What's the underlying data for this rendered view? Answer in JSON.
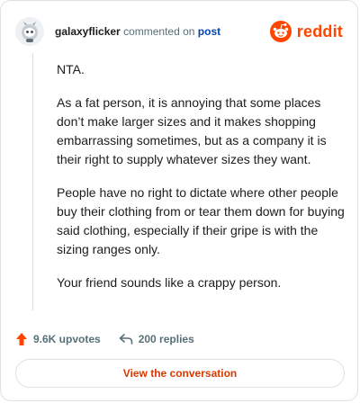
{
  "header": {
    "username": "galaxyflicker",
    "action": "commented on",
    "post_link": "post",
    "logo_text": "reddit",
    "avatar_icon": "snoo-avatar-icon",
    "logo_icon": "reddit-snoo-logo-icon"
  },
  "comment": {
    "paragraphs": [
      "NTA.",
      "As a fat person, it is annoying that some places don’t make larger sizes and it makes shopping embarrassing sometimes, but as a company it is their right to supply whatever sizes they want.",
      "People have no right to dictate where other people buy their clothing from or tear them down for buying said clothing, especially if their gripe is with the sizing ranges only.",
      "Your friend sounds like a crappy person."
    ]
  },
  "stats": {
    "upvotes": "9.6K upvotes",
    "replies": "200 replies",
    "upvote_icon": "upvote-arrow-icon",
    "reply_icon": "reply-arrow-icon"
  },
  "cta": {
    "label": "View the conversation"
  },
  "colors": {
    "brand": "#ff4500",
    "link": "#0045ac",
    "muted": "#576f76",
    "cta_text": "#d93900",
    "border": "#dfe1e3"
  }
}
